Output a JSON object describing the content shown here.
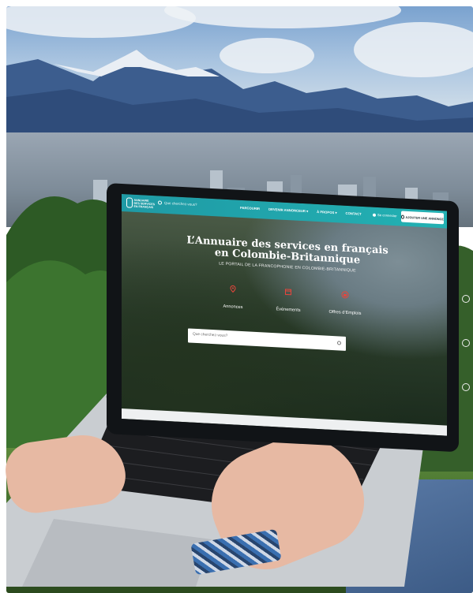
{
  "site": {
    "logo_lines": [
      "ANNUAIRE",
      "DES SERVICES",
      "EN FRANÇAIS"
    ],
    "search_placeholder": "Que cherchez-vous?",
    "nav": {
      "links": [
        "PARCOURIR",
        "DEVENIR ANNONCEUR ▾",
        "À PROPOS ▾",
        "CONTACT"
      ],
      "login": "Se connecter",
      "cta": "AJOUTER UNE ANNONCE"
    },
    "hero": {
      "title_line1": "L’Annuaire des services en français",
      "title_line2": "en Colombie-Britannique",
      "subtitle": "LE PORTAIL DE LA FRANCOPHONIE EN COLOMBIE-BRITANNIQUE"
    },
    "categories": [
      {
        "label": "Annonces",
        "icon": "map-pin-icon"
      },
      {
        "label": "Événements",
        "icon": "calendar-icon"
      },
      {
        "label": "Offres d’Emplois",
        "icon": "briefcase-icon"
      }
    ],
    "main_search_placeholder": "Que cherchez-vous?",
    "colors": {
      "nav": "#1f9aa5",
      "accent_icons": "#e8453c",
      "title": "#ffffff"
    }
  }
}
